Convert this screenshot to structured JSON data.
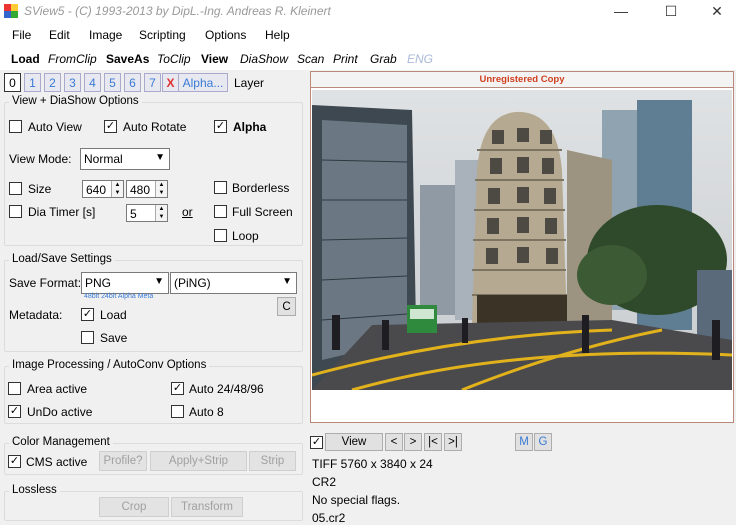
{
  "window": {
    "title": "SView5 - (C) 1993-2013 by DipL.-Ing. Andreas R. Kleinert",
    "minimize_glyph": "—",
    "maximize_glyph": "☐",
    "close_glyph": "✕"
  },
  "menu": [
    "File",
    "Edit",
    "Image",
    "Scripting",
    "Options",
    "Help"
  ],
  "toolbar": {
    "load": "Load",
    "fromclip": "FromClip",
    "saveas": "SaveAs",
    "toclip": "ToClip",
    "view": "View",
    "diashow": "DiaShow",
    "scan": "Scan",
    "print": "Print",
    "grab": "Grab",
    "eng": "ENG"
  },
  "layers": {
    "buttons": [
      "0",
      "1",
      "2",
      "3",
      "4",
      "5",
      "6",
      "7"
    ],
    "close": "X",
    "alpha_button": "Alpha...",
    "label": "Layer"
  },
  "view_options": {
    "title": "View + DiaShow Options",
    "auto_view": "Auto View",
    "auto_rotate": "Auto Rotate",
    "alpha": "Alpha",
    "view_mode_label": "View Mode:",
    "view_mode_value": "Normal",
    "size_label": "Size",
    "size_w": "640",
    "size_h": "480",
    "borderless": "Borderless",
    "dia_timer": "Dia Timer [s]",
    "dia_value": "5",
    "or_label": "or",
    "full_screen": "Full Screen",
    "loop": "Loop"
  },
  "load_save": {
    "title": "Load/Save Settings",
    "format_label": "Save Format:",
    "format_value": "PNG",
    "format_desc": "(PiNG)",
    "format_hint": "48bit 24bit Alpha Meta",
    "metadata_label": "Metadata:",
    "load": "Load",
    "save": "Save",
    "c_button": "C"
  },
  "processing": {
    "title": "Image Processing / AutoConv Options",
    "area_active": "Area active",
    "auto_2448": "Auto 24/48/96",
    "undo_active": "UnDo active",
    "auto8": "Auto 8"
  },
  "color_mgmt": {
    "title": "Color Management",
    "cms_active": "CMS active",
    "profile": "Profile?",
    "apply_strip": "Apply+Strip",
    "strip": "Strip"
  },
  "lossless": {
    "title": "Lossless",
    "crop": "Crop",
    "transform": "Transform"
  },
  "image_panel": {
    "unregistered": "Unregistered Copy",
    "view_button": "View",
    "nav_prev": "<",
    "nav_next": ">",
    "nav_first": "|<",
    "nav_last": ">|",
    "m_button": "M",
    "g_button": "G",
    "info_format": "TIFF 5760 x 3840 x 24",
    "info_type": "CR2",
    "info_flags": "No special flags.",
    "info_file": "05.cr2"
  },
  "colors": {
    "accent_blue": "#3a7bd5",
    "unregistered_red": "#d04020",
    "disabled_gray": "#a0a0a0"
  }
}
